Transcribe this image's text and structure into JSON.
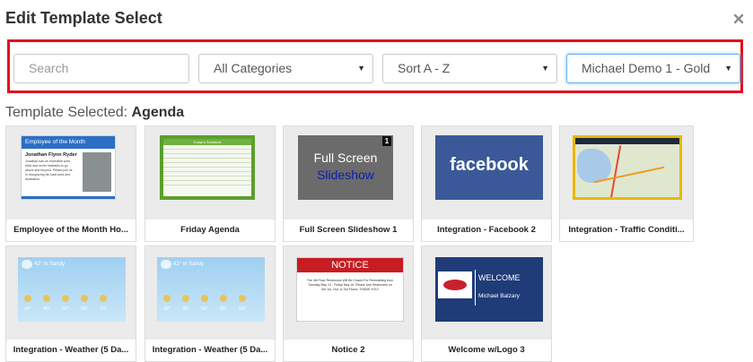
{
  "dialog": {
    "title": "Edit Template Select",
    "close_glyph": "×"
  },
  "filters": {
    "search_placeholder": "Search",
    "category": "All Categories",
    "sort": "Sort A - Z",
    "account": "Michael Demo 1 - Gold",
    "caret": "▼",
    "highlight_color": "#e0111f"
  },
  "selected": {
    "prefix": "Template Selected:",
    "name": "Agenda"
  },
  "templates": [
    {
      "label": "Employee of the Month Ho...",
      "thumb": {
        "heading": "Employee of the Month",
        "person": "Jonathan Flynn Ryder",
        "body": "Jonathan has an incredible work ethic and never hesitates to go above and beyond. Please join us in recognizing his hard work and dedication."
      }
    },
    {
      "label": "Friday Agenda",
      "thumb": {
        "heading": "Today's Schedule"
      }
    },
    {
      "label": "Full Screen Slideshow 1",
      "thumb": {
        "line1": "Full Screen",
        "line2": "Slideshow",
        "badge": "1"
      }
    },
    {
      "label": "Integration - Facebook 2",
      "thumb": {
        "word": "facebook"
      }
    },
    {
      "label": "Integration - Traffic Conditi...",
      "thumb": {}
    },
    {
      "label": "Integration - Weather (5 Da...",
      "thumb": {
        "location": "42° in Sandy",
        "temps": [
          "42°",
          "46°",
          "50°",
          "56°",
          "53°"
        ]
      }
    },
    {
      "label": "Integration - Weather (5 Da...",
      "thumb": {
        "location": "42° in Sandy",
        "temps": [
          "42°",
          "46°",
          "50°",
          "56°",
          "53°"
        ]
      }
    },
    {
      "label": "Notice 2",
      "thumb": {
        "heading": "NOTICE",
        "body": "The 4th Floor Restrooms Will Be Closed For Remodeling from Tuesday May 13 - Friday May 16. Please Use Restrooms on the 1st, 2nd, or 3rd Floors. THANK YOU!"
      }
    },
    {
      "label": "Welcome w/Logo 3",
      "thumb": {
        "heading": "WELCOME",
        "name": "Michael Balzary"
      }
    }
  ]
}
